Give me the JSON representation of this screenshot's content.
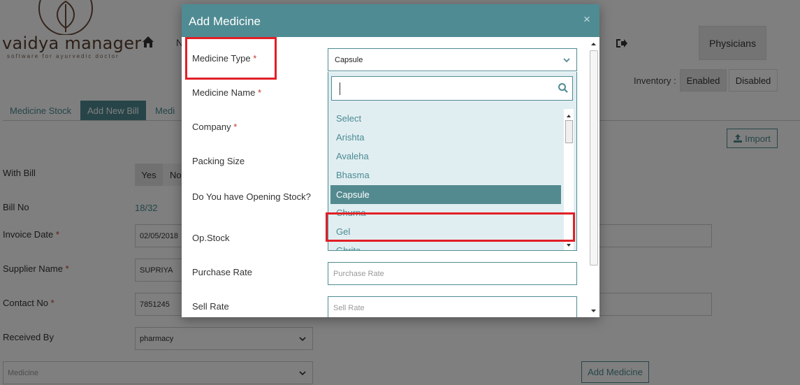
{
  "app": {
    "logo_text": "vaidya manager",
    "logo_tagline": "software for ayurvedic doctor",
    "nav_letter": "N",
    "physicians_label": "Physicians",
    "inventory_label": "Inventory :",
    "inventory_enabled": "Enabled",
    "inventory_disabled": "Disabled"
  },
  "tabs": [
    {
      "label": "Medicine Stock"
    },
    {
      "label": "Add New Bill",
      "active": true
    },
    {
      "label": "Medi"
    }
  ],
  "import_label": "Import",
  "form": {
    "with_bill_label": "With Bill",
    "yes_label": "Yes",
    "no_label": "No",
    "bill_no_label": "Bill No",
    "bill_no_value": "18/32",
    "invoice_date_label": "Invoice Date",
    "invoice_date_value": "02/05/2018",
    "supplier_name_label": "Supplier Name",
    "supplier_name_value": "SUPRIYA",
    "contact_no_label": "Contact No",
    "contact_no_value": "7851245",
    "received_by_label": "Received By",
    "received_by_value": "pharmacy",
    "medicine_select_placeholder": "Medicine",
    "add_medicine_label": "Add Medicine",
    "required_mark": "*"
  },
  "modal": {
    "title": "Add Medicine",
    "close": "×",
    "fields": {
      "medicine_type_label": "Medicine Type",
      "medicine_type_value": "Capsule",
      "medicine_name_label": "Medicine Name",
      "company_label": "Company",
      "packing_size_label": "Packing Size",
      "opening_stock_label": "Do You have Opening Stock?",
      "op_stock_label": "Op.Stock",
      "purchase_rate_label": "Purchase Rate",
      "purchase_rate_placeholder": "Purchase Rate",
      "sell_rate_label": "Sell Rate",
      "sell_rate_placeholder": "Sell Rate"
    },
    "dropdown": {
      "search_value": "",
      "options": [
        "Select",
        "Arishta",
        "Avaleha",
        "Bhasma",
        "Capsule",
        "Churna",
        "Gel",
        "Ghrita"
      ],
      "selected": "Capsule"
    }
  },
  "colors": {
    "accent": "#4f8b93",
    "highlight": "#e21f26"
  }
}
